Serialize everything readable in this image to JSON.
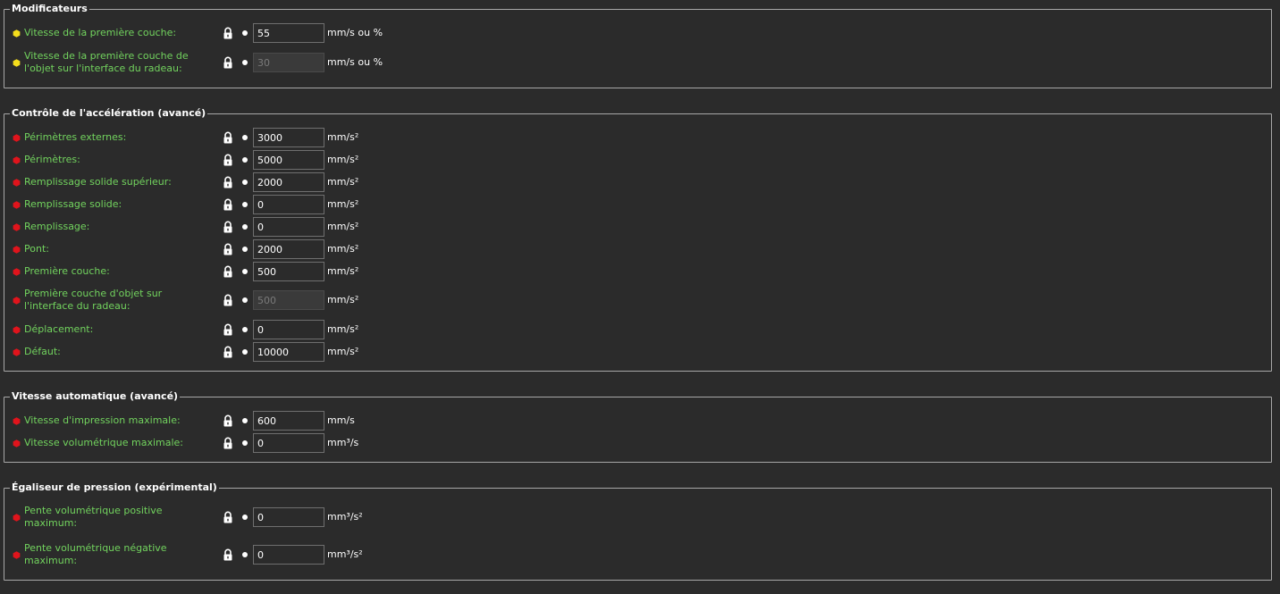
{
  "colors": {
    "background": "#2b2b2b",
    "label_green": "#72d35e",
    "dot_yellow": "#f4dd1c",
    "dot_red": "#e0141c",
    "group_border": "#a8a8a8"
  },
  "groups": [
    {
      "title": "Modificateurs",
      "rows": [
        {
          "label": "Vitesse de la première couche:",
          "value": "55",
          "unit": "mm/s ou %",
          "dot": "yellow",
          "disabled": false
        },
        {
          "label": "Vitesse de la première couche de l'objet sur l'interface du radeau:",
          "label_line1": "Vitesse de la première couche de",
          "label_line2": "l'objet sur l'interface du radeau:",
          "value": "30",
          "unit": "mm/s ou %",
          "dot": "yellow",
          "disabled": true
        }
      ]
    },
    {
      "title": "Contrôle de l'accélération (avancé)",
      "rows": [
        {
          "label": "Périmètres externes:",
          "value": "3000",
          "unit": "mm/s²",
          "dot": "red",
          "disabled": false
        },
        {
          "label": "Périmètres:",
          "value": "5000",
          "unit": "mm/s²",
          "dot": "red",
          "disabled": false
        },
        {
          "label": "Remplissage solide supérieur:",
          "value": "2000",
          "unit": "mm/s²",
          "dot": "red",
          "disabled": false
        },
        {
          "label": "Remplissage solide:",
          "value": "0",
          "unit": "mm/s²",
          "dot": "red",
          "disabled": false
        },
        {
          "label": "Remplissage:",
          "value": "0",
          "unit": "mm/s²",
          "dot": "red",
          "disabled": false
        },
        {
          "label": "Pont:",
          "value": "2000",
          "unit": "mm/s²",
          "dot": "red",
          "disabled": false
        },
        {
          "label": "Première couche:",
          "value": "500",
          "unit": "mm/s²",
          "dot": "red",
          "disabled": false
        },
        {
          "label": "Première couche d'objet sur l'interface du radeau:",
          "label_line1": "Première couche d'objet sur",
          "label_line2": "l'interface du radeau:",
          "value": "500",
          "unit": "mm/s²",
          "dot": "red",
          "disabled": true
        },
        {
          "label": "Déplacement:",
          "value": "0",
          "unit": "mm/s²",
          "dot": "red",
          "disabled": false
        },
        {
          "label": "Défaut:",
          "value": "10000",
          "unit": "mm/s²",
          "dot": "red",
          "disabled": false
        }
      ]
    },
    {
      "title": "Vitesse automatique (avancé)",
      "rows": [
        {
          "label": "Vitesse d'impression maximale:",
          "value": "600",
          "unit": "mm/s",
          "dot": "red",
          "disabled": false
        },
        {
          "label": "Vitesse volumétrique maximale:",
          "value": "0",
          "unit": "mm³/s",
          "dot": "red",
          "disabled": false
        }
      ]
    },
    {
      "title": "Égaliseur de pression (expérimental)",
      "rows": [
        {
          "label": "Pente volumétrique positive maximum:",
          "label_line1": "Pente volumétrique positive",
          "label_line2": "maximum:",
          "value": "0",
          "unit": "mm³/s²",
          "dot": "red",
          "disabled": false
        },
        {
          "label": "Pente volumétrique négative maximum:",
          "label_line1": "Pente volumétrique négative",
          "label_line2": "maximum:",
          "value": "0",
          "unit": "mm³/s²",
          "dot": "red",
          "disabled": false
        }
      ]
    }
  ]
}
